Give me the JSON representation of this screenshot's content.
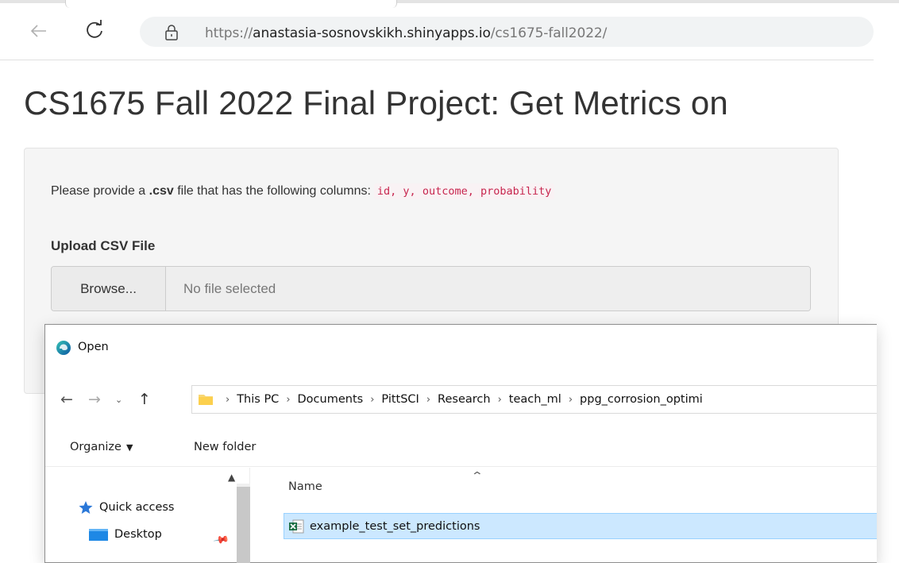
{
  "browser": {
    "url_scheme": "https://",
    "url_host": "anastasia-sosnovskikh.shinyapps.io",
    "url_path": "/cs1675-fall2022/"
  },
  "page": {
    "title": "CS1675 Fall 2022 Final Project: Get Metrics on",
    "instruction_pre": "Please provide a ",
    "instruction_bold": ".csv",
    "instruction_post": " file that has the following columns:",
    "columns_code": "id, y, outcome, probability",
    "upload_label": "Upload CSV File",
    "browse_label": "Browse...",
    "file_placeholder": "No file selected"
  },
  "dialog": {
    "title": "Open",
    "breadcrumb": [
      "This PC",
      "Documents",
      "PittSCI",
      "Research",
      "teach_ml",
      "ppg_corrosion_optimi"
    ],
    "organize_label": "Organize",
    "new_folder_label": "New folder",
    "nav_items": [
      "Quick access",
      "Desktop"
    ],
    "column_name": "Name",
    "files": [
      "example_test_set_predictions"
    ]
  },
  "colors": {
    "selection_bg": "#cce8ff",
    "code_text": "#c7254e",
    "folder_yellow": "#f8d775"
  },
  "icons": [
    "back-arrow-icon",
    "reload-icon",
    "lock-icon",
    "edge-logo-icon",
    "folder-icon",
    "quick-access-star-icon",
    "desktop-icon",
    "pin-icon",
    "excel-file-icon"
  ]
}
